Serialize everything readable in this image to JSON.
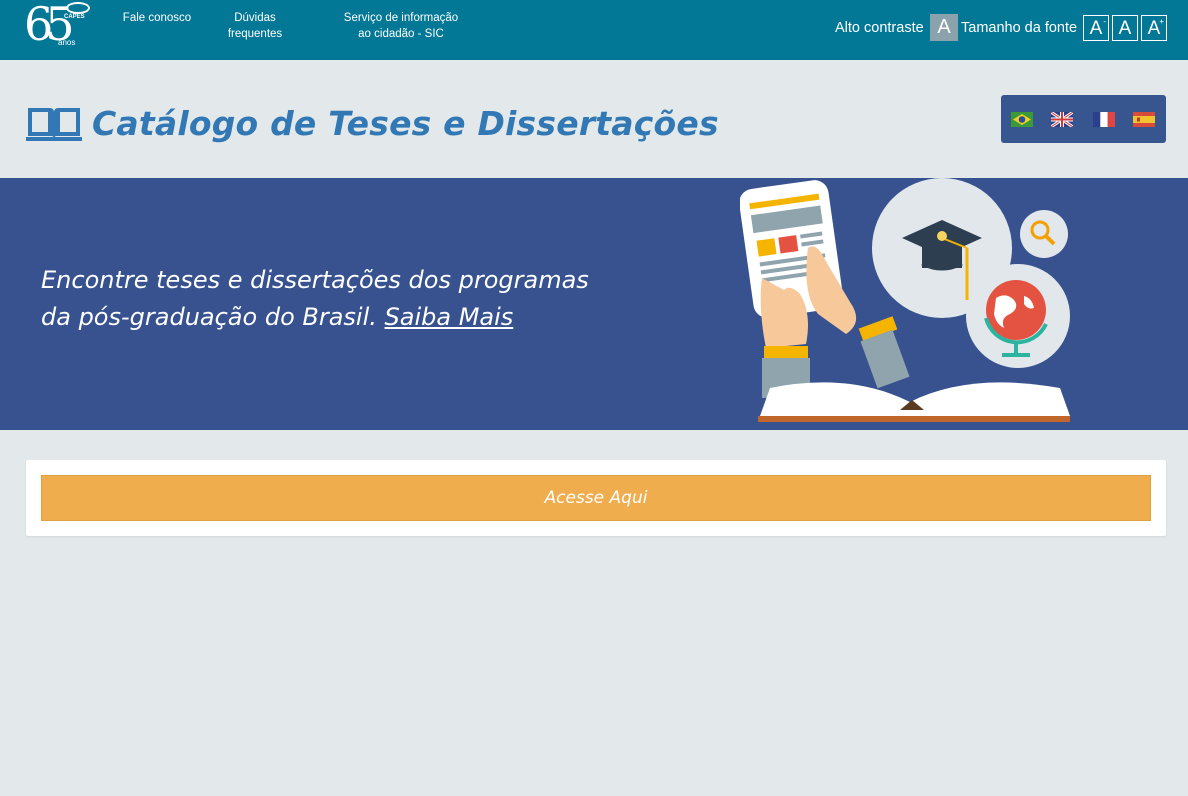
{
  "logo": {
    "number": "65",
    "years_label": "anos",
    "org": "CAPES"
  },
  "topnav": {
    "fale": "Fale conosco",
    "duvidas": "Dúvidas\nfrequentes",
    "sic": "Serviço de informação\nao cidadão - SIC"
  },
  "accessibility": {
    "alto_contraste_label": "Alto contraste",
    "alto_contraste_btn": "A",
    "tamanho_fonte_label": "Tamanho da fonte",
    "font_buttons": [
      {
        "letter": "A",
        "sign": "-"
      },
      {
        "letter": "A",
        "sign": ""
      },
      {
        "letter": "A",
        "sign": "+"
      }
    ]
  },
  "header": {
    "title": "Catálogo de Teses e Dissertações",
    "icon": "book-icon",
    "languages": [
      "pt-BR flag",
      "en flag",
      "fr flag",
      "es flag"
    ]
  },
  "banner": {
    "text": "Encontre teses e dissertações dos programas da pós-graduação do Brasil.",
    "link": "Saiba Mais",
    "illustration": "graduation-study-illustration"
  },
  "card": {
    "button_label": "Acesse Aqui"
  },
  "colors": {
    "topbar": "#037796",
    "banner": "#37528f",
    "title": "#3278b4",
    "button": "#f0ad4e",
    "background": "#e3e9ea"
  }
}
